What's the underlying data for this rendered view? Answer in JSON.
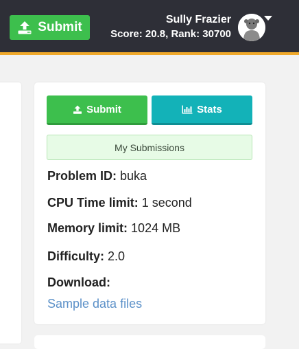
{
  "header": {
    "submit_label": "Submit",
    "user_name": "Sully Frazier",
    "score_rank": "Score: 20.8, Rank: 30700"
  },
  "panel": {
    "submit_label": "Submit",
    "stats_label": "Stats",
    "my_submissions_label": "My Submissions",
    "problem_id_label": "Problem ID:",
    "problem_id_value": "buka",
    "cpu_time_label": "CPU Time limit:",
    "cpu_time_value": "1 second",
    "memory_label": "Memory limit:",
    "memory_value": "1024 MB",
    "difficulty_label": "Difficulty:",
    "difficulty_value": "2.0",
    "download_label": "Download:",
    "sample_link_label": "Sample data files"
  },
  "icons": {
    "upload": "upload-icon",
    "stats": "bar-chart-icon",
    "avatar": "avatar",
    "caret": "caret-down-icon"
  },
  "colors": {
    "header_bg": "#2e2f37",
    "header_accent": "#f0a92b",
    "submit_green": "#3dbf4d",
    "stats_teal": "#13b2b8",
    "link_blue": "#5b90c8"
  }
}
